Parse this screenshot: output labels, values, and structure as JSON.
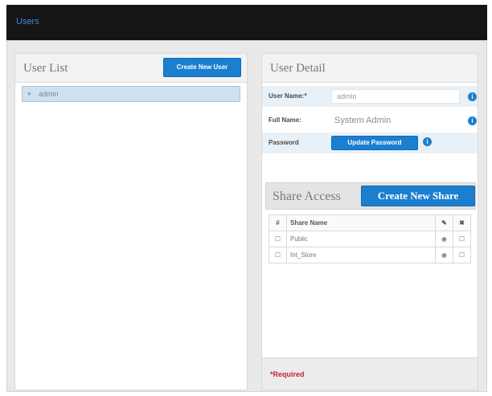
{
  "app": {
    "title": "Users"
  },
  "user_list": {
    "title": "User List",
    "create_button": "Create New User",
    "items": [
      {
        "name": "admin"
      }
    ]
  },
  "user_detail": {
    "title": "User Detail",
    "fields": {
      "username": {
        "label": "User Name:*",
        "value": "admin"
      },
      "fullname": {
        "label": "Full Name:",
        "value": "System Admin"
      },
      "password": {
        "label": "Password",
        "button": "Update Password"
      }
    }
  },
  "share_access": {
    "title": "Share Access",
    "create_button": "Create New Share",
    "columns": {
      "check": "#",
      "name": "Share Name",
      "edit_icon": "pencil-icon",
      "delete_icon": "cross-icon"
    },
    "rows": [
      {
        "name": "Public"
      },
      {
        "name": "Int_Store"
      }
    ]
  },
  "footer": {
    "required_note": "*Required"
  },
  "colors": {
    "accent": "#1b7fd0",
    "danger": "#c21f35",
    "topbar": "#151515"
  }
}
